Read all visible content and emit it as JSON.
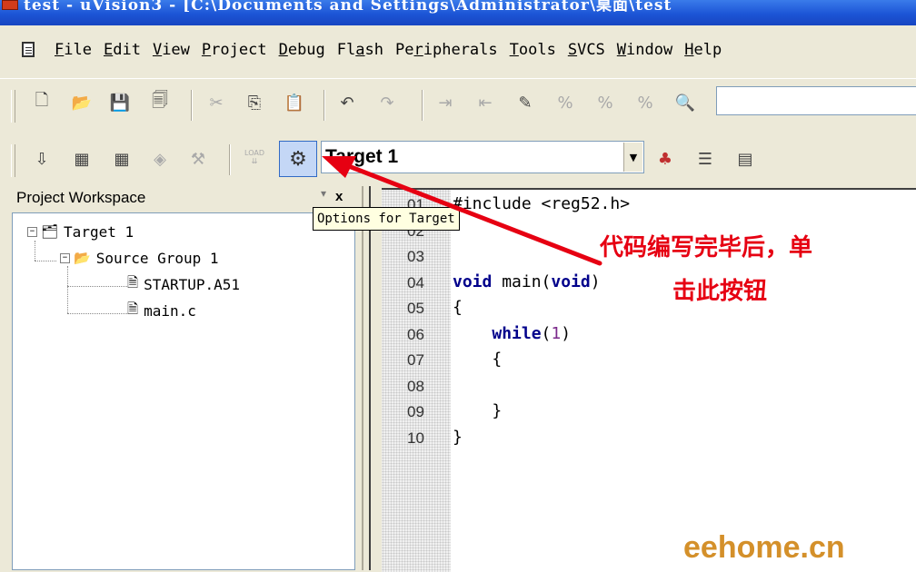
{
  "window": {
    "title": "test - uVision3 - [C:\\Documents and Settings\\Administrator\\桌面\\test"
  },
  "menu": [
    {
      "acc": "F",
      "rest": "ile"
    },
    {
      "acc": "E",
      "rest": "dit"
    },
    {
      "acc": "V",
      "rest": "iew"
    },
    {
      "acc": "P",
      "rest": "roject"
    },
    {
      "acc": "D",
      "rest": "ebug"
    },
    {
      "pre": "Fl",
      "acc": "a",
      "rest": "sh"
    },
    {
      "pre": "Pe",
      "acc": "r",
      "rest": "ipherals"
    },
    {
      "acc": "T",
      "rest": "ools"
    },
    {
      "acc": "S",
      "rest": "VCS"
    },
    {
      "acc": "W",
      "rest": "indow"
    },
    {
      "acc": "H",
      "rest": "elp"
    }
  ],
  "toolbar2": {
    "target_value": "Target 1",
    "load_label": "LOAD"
  },
  "tooltip": {
    "text": "Options for Target"
  },
  "workspace": {
    "title": "Project Workspace",
    "close": "x",
    "tree": {
      "target": "Target 1",
      "group": "Source Group 1",
      "files": [
        "STARTUP.A51",
        "main.c"
      ]
    }
  },
  "editor": {
    "line_numbers": [
      "01",
      "02",
      "03",
      "04",
      "05",
      "06",
      "07",
      "08",
      "09",
      "10"
    ],
    "lines": [
      "#include <reg52.h>",
      "",
      "",
      "void main(void)",
      "{",
      "    while(1)",
      "    {",
      "",
      "    }",
      "}"
    ]
  },
  "annotation": {
    "line1": "代码编写完毕后，单",
    "line2": "击此按钮"
  },
  "watermark": "eehome.cn",
  "colors": {
    "annotation_red": "#e60012",
    "keyword": "#00008b",
    "watermark": "#d4902a"
  }
}
